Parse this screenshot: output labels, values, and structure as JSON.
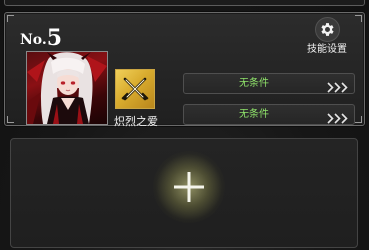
{
  "slot": {
    "prefix": "No.",
    "number": "5"
  },
  "skill_settings": {
    "label": "技能设置",
    "icon": "gear-icon"
  },
  "portrait": {
    "icon": "character-portrait"
  },
  "skill": {
    "name": "炽烈之爱",
    "icon": "crossed-swords-icon"
  },
  "conditions": [
    {
      "label": "无条件",
      "icon": "triple-chevron-right-icon"
    },
    {
      "label": "无条件",
      "icon": "triple-chevron-right-icon"
    }
  ],
  "empty_slot": {
    "icon": "plus-icon"
  },
  "colors": {
    "condition_text": "#8fe36a",
    "skill_badge": "#d9ac2e",
    "portrait_bg": "#8a1014",
    "card_border": "#6a6a6a"
  }
}
